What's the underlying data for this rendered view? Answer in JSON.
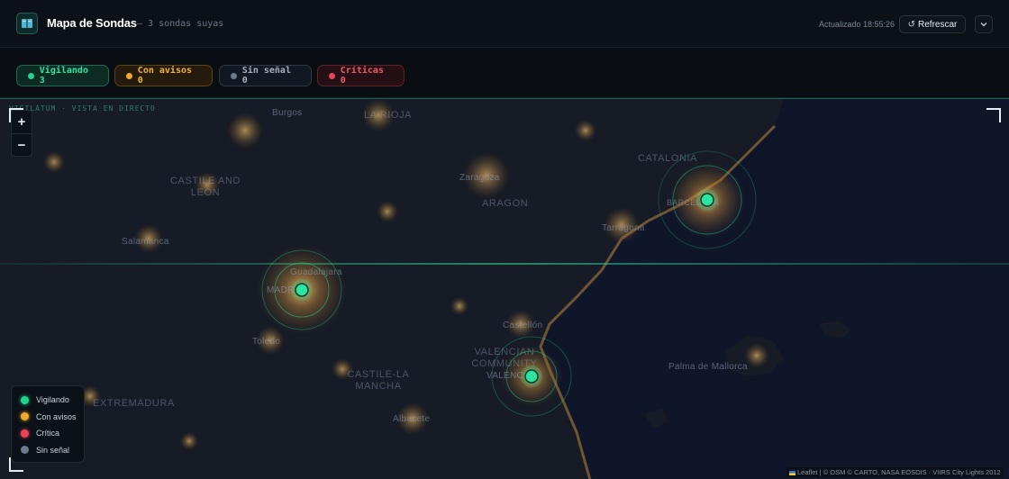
{
  "header": {
    "title": "Mapa de Sondas",
    "subtitle": "— 3 sondas suyas",
    "updated": "Actualizado 18:55:26",
    "refresh_label": "Refrescar",
    "refresh_icon": "↺"
  },
  "status_chips": {
    "vigilando": "Vigilando 3",
    "con_avisos": "Con avisos 0",
    "sin_senal": "Sin señal 0",
    "criticas": "Críticas 0"
  },
  "map": {
    "overlay_label": "VIGILATUM · VISTA EN DIRECTO",
    "zoom_in": "+",
    "zoom_out": "−",
    "places": {
      "burgos": "Burgos",
      "la_rioja": "LA RIOJA",
      "castile_and_leon": "CASTILE AND LEÓN",
      "catalonia": "CATALONIA",
      "zaragoza": "Zaragoza",
      "aragon": "ARAGON",
      "barcelona": "BARCELONA",
      "salamanca": "Salamanca",
      "tarragona": "Tarragona",
      "guadalajara": "Guadalajara",
      "madrid": "MADRID",
      "toledo": "Toledo",
      "castellon": "Castellón",
      "valencian_community": "VALENCIAN COMMUNITY",
      "valencia": "VALENCIA",
      "castile_la_mancha": "CASTILE-LA MANCHA",
      "palma": "Palma de Mallorca",
      "extremadura": "EXTREMADURA",
      "albacete": "Albacete"
    },
    "legend": [
      "Vigilando",
      "Con avisos",
      "Crítica",
      "Sin señal"
    ],
    "attribution": "Leaflet | © OSM © CARTO, NASA EOSDIS · VIIRS City Lights 2012"
  },
  "colors": {
    "vigilando": "#22d38d",
    "con_avisos": "#f0a92c",
    "critica": "#ea4256",
    "sin_senal": "#6c7b8d"
  }
}
